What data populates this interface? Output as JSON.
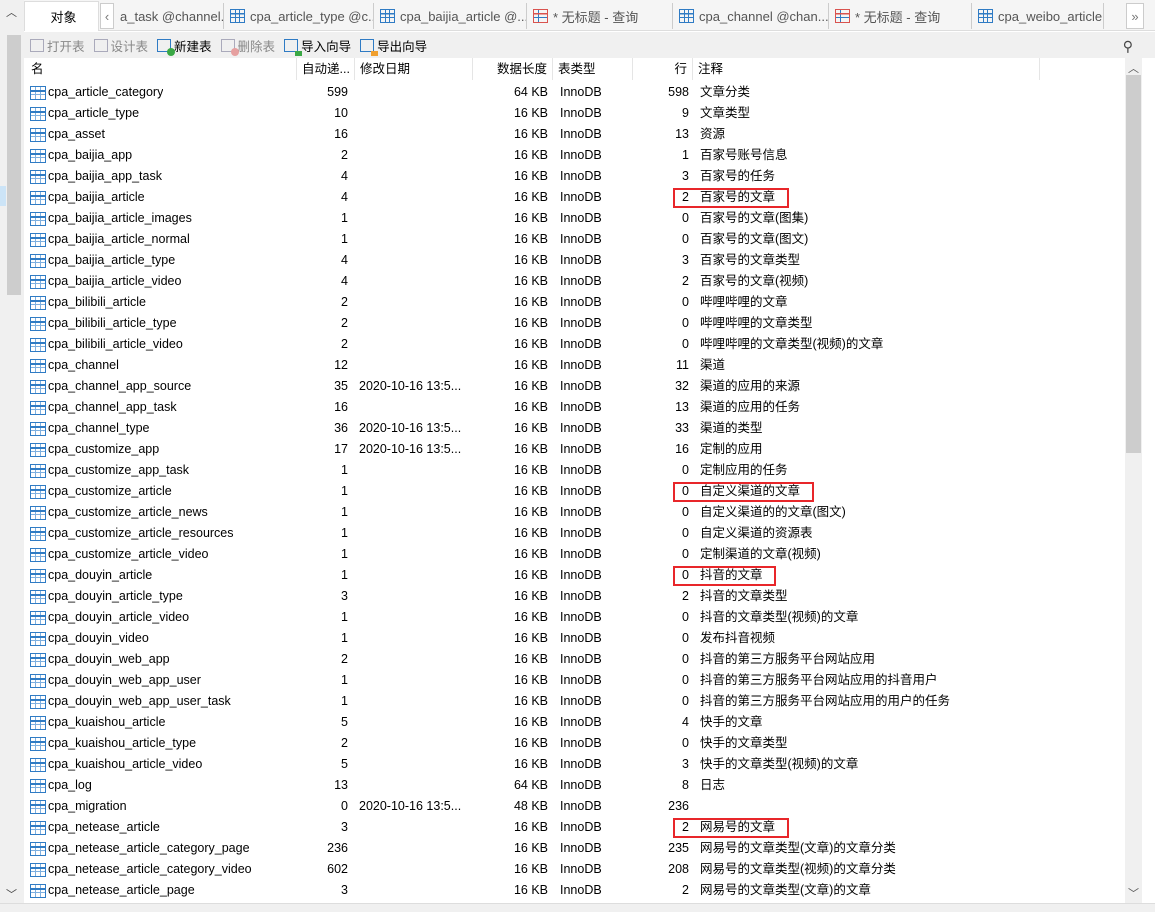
{
  "tabs": {
    "active": "对象",
    "items": [
      {
        "label": "a_task @channel...",
        "kind": "table"
      },
      {
        "label": "cpa_article_type @c...",
        "kind": "table"
      },
      {
        "label": "cpa_baijia_article @...",
        "kind": "table"
      },
      {
        "label": "* 无标题 - 查询",
        "kind": "query"
      },
      {
        "label": "cpa_channel @chan...",
        "kind": "design"
      },
      {
        "label": "* 无标题 - 查询",
        "kind": "query"
      },
      {
        "label": "cpa_weibo_article ...",
        "kind": "table"
      }
    ],
    "prev": "‹",
    "next": "»"
  },
  "toolbar": {
    "open": "打开表",
    "design": "设计表",
    "new": "新建表",
    "delete": "删除表",
    "import": "导入向导",
    "export": "导出向导"
  },
  "columns": {
    "name": "名",
    "auto": "自动递...",
    "date": "修改日期",
    "size": "数据长度",
    "type": "表类型",
    "rows": "行",
    "comment": "注释"
  },
  "highlight_color": "#e8262a",
  "rows": [
    {
      "name": "cpa_article_category",
      "auto": "599",
      "date": "",
      "size": "64 KB",
      "type": "InnoDB",
      "rows": "598",
      "comment": "文章分类"
    },
    {
      "name": "cpa_article_type",
      "auto": "10",
      "date": "",
      "size": "16 KB",
      "type": "InnoDB",
      "rows": "9",
      "comment": "文章类型"
    },
    {
      "name": "cpa_asset",
      "auto": "16",
      "date": "",
      "size": "16 KB",
      "type": "InnoDB",
      "rows": "13",
      "comment": "资源"
    },
    {
      "name": "cpa_baijia_app",
      "auto": "2",
      "date": "",
      "size": "16 KB",
      "type": "InnoDB",
      "rows": "1",
      "comment": "百家号账号信息"
    },
    {
      "name": "cpa_baijia_app_task",
      "auto": "4",
      "date": "",
      "size": "16 KB",
      "type": "InnoDB",
      "rows": "3",
      "comment": "百家号的任务"
    },
    {
      "name": "cpa_baijia_article",
      "auto": "4",
      "date": "",
      "size": "16 KB",
      "type": "InnoDB",
      "rows": "2",
      "comment": "百家号的文章",
      "highlighted": true
    },
    {
      "name": "cpa_baijia_article_images",
      "auto": "1",
      "date": "",
      "size": "16 KB",
      "type": "InnoDB",
      "rows": "0",
      "comment": "百家号的文章(图集)"
    },
    {
      "name": "cpa_baijia_article_normal",
      "auto": "1",
      "date": "",
      "size": "16 KB",
      "type": "InnoDB",
      "rows": "0",
      "comment": "百家号的文章(图文)"
    },
    {
      "name": "cpa_baijia_article_type",
      "auto": "4",
      "date": "",
      "size": "16 KB",
      "type": "InnoDB",
      "rows": "3",
      "comment": "百家号的文章类型"
    },
    {
      "name": "cpa_baijia_article_video",
      "auto": "4",
      "date": "",
      "size": "16 KB",
      "type": "InnoDB",
      "rows": "2",
      "comment": "百家号的文章(视频)"
    },
    {
      "name": "cpa_bilibili_article",
      "auto": "2",
      "date": "",
      "size": "16 KB",
      "type": "InnoDB",
      "rows": "0",
      "comment": "哔哩哔哩的文章"
    },
    {
      "name": "cpa_bilibili_article_type",
      "auto": "2",
      "date": "",
      "size": "16 KB",
      "type": "InnoDB",
      "rows": "0",
      "comment": "哔哩哔哩的文章类型"
    },
    {
      "name": "cpa_bilibili_article_video",
      "auto": "2",
      "date": "",
      "size": "16 KB",
      "type": "InnoDB",
      "rows": "0",
      "comment": "哔哩哔哩的文章类型(视频)的文章"
    },
    {
      "name": "cpa_channel",
      "auto": "12",
      "date": "",
      "size": "16 KB",
      "type": "InnoDB",
      "rows": "11",
      "comment": "渠道"
    },
    {
      "name": "cpa_channel_app_source",
      "auto": "35",
      "date": "2020-10-16 13:5...",
      "size": "16 KB",
      "type": "InnoDB",
      "rows": "32",
      "comment": "渠道的应用的来源"
    },
    {
      "name": "cpa_channel_app_task",
      "auto": "16",
      "date": "",
      "size": "16 KB",
      "type": "InnoDB",
      "rows": "13",
      "comment": "渠道的应用的任务"
    },
    {
      "name": "cpa_channel_type",
      "auto": "36",
      "date": "2020-10-16 13:5...",
      "size": "16 KB",
      "type": "InnoDB",
      "rows": "33",
      "comment": "渠道的类型"
    },
    {
      "name": "cpa_customize_app",
      "auto": "17",
      "date": "2020-10-16 13:5...",
      "size": "16 KB",
      "type": "InnoDB",
      "rows": "16",
      "comment": "定制的应用"
    },
    {
      "name": "cpa_customize_app_task",
      "auto": "1",
      "date": "",
      "size": "16 KB",
      "type": "InnoDB",
      "rows": "0",
      "comment": "定制应用的任务"
    },
    {
      "name": "cpa_customize_article",
      "auto": "1",
      "date": "",
      "size": "16 KB",
      "type": "InnoDB",
      "rows": "0",
      "comment": "自定义渠道的文章",
      "highlighted": true
    },
    {
      "name": "cpa_customize_article_news",
      "auto": "1",
      "date": "",
      "size": "16 KB",
      "type": "InnoDB",
      "rows": "0",
      "comment": "自定义渠道的的文章(图文)"
    },
    {
      "name": "cpa_customize_article_resources",
      "auto": "1",
      "date": "",
      "size": "16 KB",
      "type": "InnoDB",
      "rows": "0",
      "comment": "自定义渠道的资源表"
    },
    {
      "name": "cpa_customize_article_video",
      "auto": "1",
      "date": "",
      "size": "16 KB",
      "type": "InnoDB",
      "rows": "0",
      "comment": "定制渠道的文章(视频)"
    },
    {
      "name": "cpa_douyin_article",
      "auto": "1",
      "date": "",
      "size": "16 KB",
      "type": "InnoDB",
      "rows": "0",
      "comment": "抖音的文章",
      "highlighted": true
    },
    {
      "name": "cpa_douyin_article_type",
      "auto": "3",
      "date": "",
      "size": "16 KB",
      "type": "InnoDB",
      "rows": "2",
      "comment": "抖音的文章类型"
    },
    {
      "name": "cpa_douyin_article_video",
      "auto": "1",
      "date": "",
      "size": "16 KB",
      "type": "InnoDB",
      "rows": "0",
      "comment": "抖音的文章类型(视频)的文章"
    },
    {
      "name": "cpa_douyin_video",
      "auto": "1",
      "date": "",
      "size": "16 KB",
      "type": "InnoDB",
      "rows": "0",
      "comment": "发布抖音视频"
    },
    {
      "name": "cpa_douyin_web_app",
      "auto": "2",
      "date": "",
      "size": "16 KB",
      "type": "InnoDB",
      "rows": "0",
      "comment": "抖音的第三方服务平台网站应用"
    },
    {
      "name": "cpa_douyin_web_app_user",
      "auto": "1",
      "date": "",
      "size": "16 KB",
      "type": "InnoDB",
      "rows": "0",
      "comment": "抖音的第三方服务平台网站应用的抖音用户"
    },
    {
      "name": "cpa_douyin_web_app_user_task",
      "auto": "1",
      "date": "",
      "size": "16 KB",
      "type": "InnoDB",
      "rows": "0",
      "comment": "抖音的第三方服务平台网站应用的用户的任务"
    },
    {
      "name": "cpa_kuaishou_article",
      "auto": "5",
      "date": "",
      "size": "16 KB",
      "type": "InnoDB",
      "rows": "4",
      "comment": "快手的文章"
    },
    {
      "name": "cpa_kuaishou_article_type",
      "auto": "2",
      "date": "",
      "size": "16 KB",
      "type": "InnoDB",
      "rows": "0",
      "comment": "快手的文章类型"
    },
    {
      "name": "cpa_kuaishou_article_video",
      "auto": "5",
      "date": "",
      "size": "16 KB",
      "type": "InnoDB",
      "rows": "3",
      "comment": "快手的文章类型(视频)的文章"
    },
    {
      "name": "cpa_log",
      "auto": "13",
      "date": "",
      "size": "64 KB",
      "type": "InnoDB",
      "rows": "8",
      "comment": "日志"
    },
    {
      "name": "cpa_migration",
      "auto": "0",
      "date": "2020-10-16 13:5...",
      "size": "48 KB",
      "type": "InnoDB",
      "rows": "236",
      "comment": ""
    },
    {
      "name": "cpa_netease_article",
      "auto": "3",
      "date": "",
      "size": "16 KB",
      "type": "InnoDB",
      "rows": "2",
      "comment": "网易号的文章",
      "highlighted": true
    },
    {
      "name": "cpa_netease_article_category_page",
      "auto": "236",
      "date": "",
      "size": "16 KB",
      "type": "InnoDB",
      "rows": "235",
      "comment": "网易号的文章类型(文章)的文章分类"
    },
    {
      "name": "cpa_netease_article_category_video",
      "auto": "602",
      "date": "",
      "size": "16 KB",
      "type": "InnoDB",
      "rows": "208",
      "comment": "网易号的文章类型(视频)的文章分类"
    },
    {
      "name": "cpa_netease_article_page",
      "auto": "3",
      "date": "",
      "size": "16 KB",
      "type": "InnoDB",
      "rows": "2",
      "comment": "网易号的文章类型(文章)的文章"
    }
  ]
}
